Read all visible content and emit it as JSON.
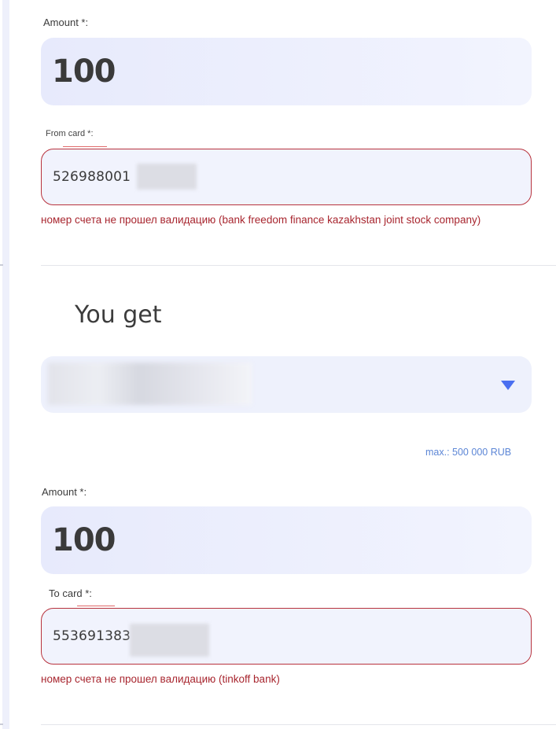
{
  "give": {
    "amount_label": "Amount *:",
    "amount_value": "100",
    "card_label": "From card *:",
    "card_value": "526988001",
    "card_error": "номер счета не прошел валидацию (bank freedom finance kazakhstan joint stock company)"
  },
  "get": {
    "section_title": "You get",
    "max_note": "max.: 500 000 RUB",
    "amount_label": "Amount *:",
    "amount_value": "100",
    "card_label": "To card *:",
    "card_value": "553691383",
    "card_error": "номер счета не прошел валидацию (tinkoff bank)"
  },
  "icons": {
    "dropdown": "chevron-down-icon"
  },
  "colors": {
    "error": "#a8262f",
    "error_border": "#b8323d",
    "accent": "#4a6ff0",
    "max_note": "#5c86d6",
    "field_bg": "#eef1fc"
  }
}
